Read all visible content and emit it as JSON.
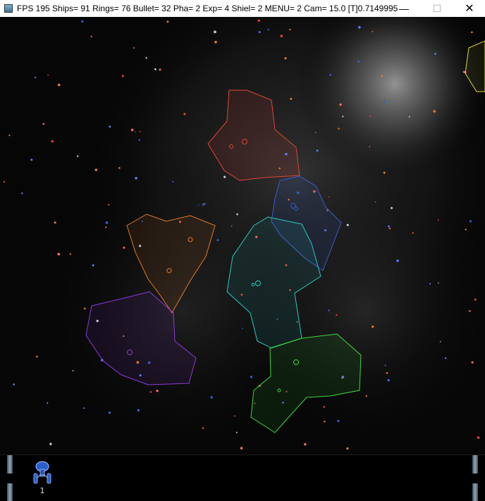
{
  "window": {
    "title": "FPS 195 Ships= 91 Rings= 76 Bullet= 32 Pha= 2 Exp= 4 Shiel= 2 MENU= 2 Cam= 15.0 [T]0.7149995...",
    "minimize_glyph": "—",
    "maximize_glyph": "☐",
    "close_glyph": "✕"
  },
  "hud": {
    "selected_ship_icon": "starship-icon",
    "selected_ship_count": "1"
  },
  "colors": {
    "red_faction": "#e0453a",
    "blue_faction": "#3a5cc8",
    "orange_faction": "#e07a2a",
    "teal_faction": "#2ac8c0",
    "purple_faction": "#8a3ad8",
    "green_faction": "#3ad83a",
    "yellow_faction": "#d8d83a"
  }
}
